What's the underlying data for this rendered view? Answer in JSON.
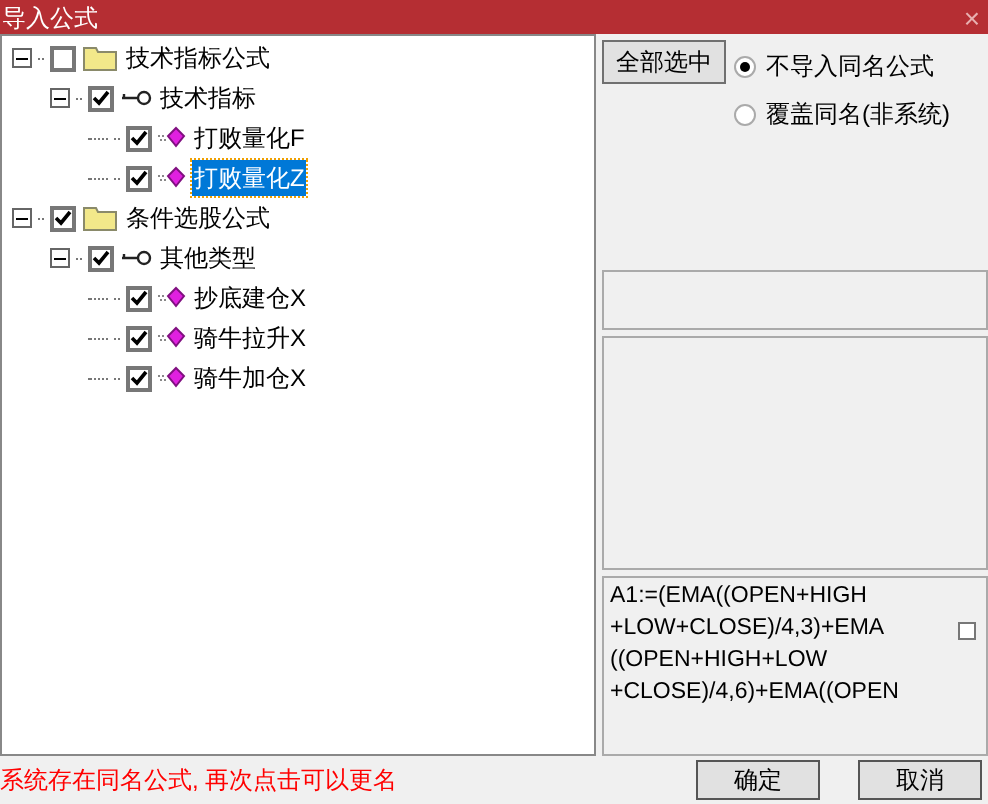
{
  "window": {
    "title": "导入公式",
    "close": "×"
  },
  "tree": [
    {
      "label": "技术指标公式",
      "kind": "folder",
      "checked": false,
      "selected": false,
      "expanded": true,
      "children": [
        {
          "label": "技术指标",
          "kind": "key",
          "checked": true,
          "selected": false,
          "expanded": true,
          "children": [
            {
              "label": "打败量化F",
              "kind": "formula",
              "checked": true,
              "selected": false
            },
            {
              "label": "打败量化Z",
              "kind": "formula",
              "checked": true,
              "selected": true
            }
          ]
        }
      ]
    },
    {
      "label": "条件选股公式",
      "kind": "folder",
      "checked": true,
      "selected": false,
      "expanded": true,
      "children": [
        {
          "label": "其他类型",
          "kind": "key",
          "checked": true,
          "selected": false,
          "expanded": true,
          "children": [
            {
              "label": "抄底建仓X",
              "kind": "formula",
              "checked": true,
              "selected": false
            },
            {
              "label": "骑牛拉升X",
              "kind": "formula",
              "checked": true,
              "selected": false
            },
            {
              "label": "骑牛加仓X",
              "kind": "formula",
              "checked": true,
              "selected": false
            }
          ]
        }
      ]
    }
  ],
  "select_all_button": "全部选中",
  "options": [
    {
      "label": "不导入同名公式",
      "selected": true
    },
    {
      "label": "覆盖同名(非系统)",
      "selected": false
    }
  ],
  "formula_preview": "A1:=(EMA((OPEN+HIGH\n+LOW+CLOSE)/4,3)+EMA\n((OPEN+HIGH+LOW\n+CLOSE)/4,6)+EMA((OPEN",
  "preview_checkbox": {
    "checked": false
  },
  "status": "系统存在同名公式, 再次点击可以更名",
  "buttons": [
    "确定",
    "取消"
  ]
}
